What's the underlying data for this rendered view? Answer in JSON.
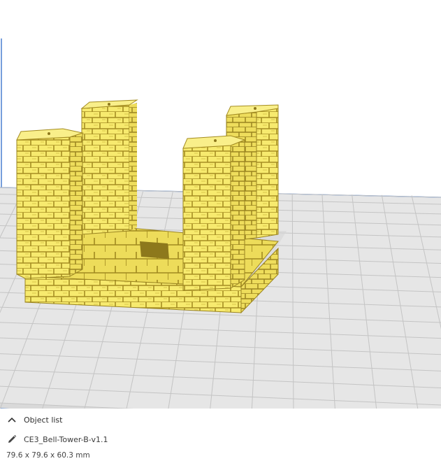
{
  "viewport": {
    "colors": {
      "background": "#ffffff",
      "build_plate": "#e6e6e6",
      "grid_line": "#c4c4c4",
      "plate_border": "#4a7fd0",
      "model_fill": "#f7ea6e",
      "model_shadow": "#c9b23a",
      "model_mortar": "#a58d22"
    }
  },
  "object_panel": {
    "header": {
      "toggle_icon": "chevron-up-icon",
      "label": "Object list"
    },
    "object": {
      "icon": "pencil-icon",
      "name": "CE3_Bell-Tower-B-v1.1"
    },
    "dimensions": "79.6 x 79.6 x 60.3 mm"
  }
}
